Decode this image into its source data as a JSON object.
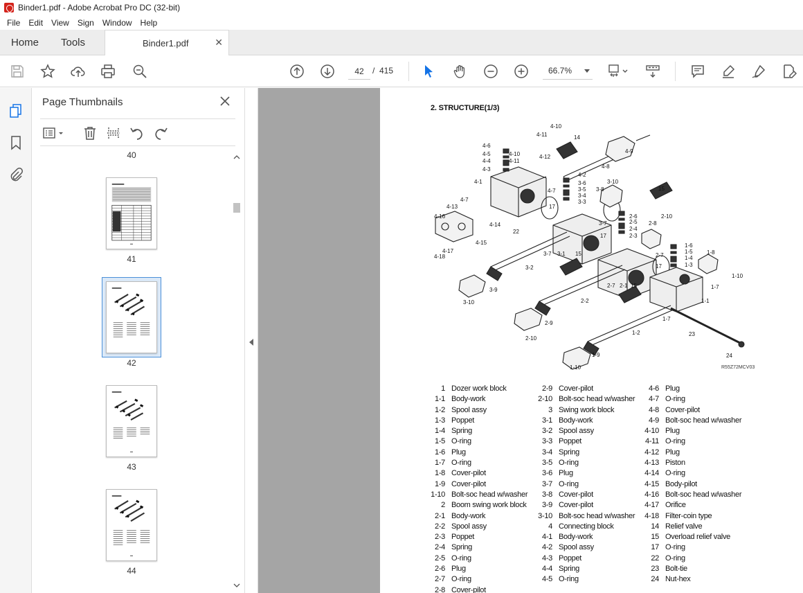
{
  "window": {
    "title": "Binder1.pdf - Adobe Acrobat Pro DC (32-bit)"
  },
  "menu": [
    "File",
    "Edit",
    "View",
    "Sign",
    "Window",
    "Help"
  ],
  "tabs": {
    "home": "Home",
    "tools": "Tools",
    "document": "Binder1.pdf"
  },
  "toolbar": {
    "current_page": "42",
    "page_separator": "/",
    "total_pages": "415",
    "zoom": "66.7%"
  },
  "thumbnail_panel": {
    "title": "Page Thumbnails",
    "pages": [
      {
        "number": "40",
        "selected": false
      },
      {
        "number": "41",
        "selected": false
      },
      {
        "number": "42",
        "selected": true
      },
      {
        "number": "43",
        "selected": false
      },
      {
        "number": "44",
        "selected": false
      }
    ]
  },
  "document": {
    "heading": "2. STRUCTURE(1/3)",
    "drawing_code": "R55Z72MCV03",
    "callouts": [
      "4-10",
      "4-11",
      "14",
      "4-6",
      "4-5",
      "4-10",
      "4-4",
      "4-11",
      "4-3",
      "4-12",
      "4-9",
      "4-8",
      "4-2",
      "4-1",
      "3-6",
      "3-5",
      "3-4",
      "3-3",
      "3-10",
      "4-7",
      "3-8",
      "15",
      "4-13",
      "4-7",
      "17",
      "2-6",
      "2-10",
      "4-16",
      "22",
      "2-5",
      "4-14",
      "2-4",
      "2-8",
      "2-3",
      "4-15",
      "17",
      "3-7",
      "1-6",
      "4-17",
      "3-7",
      "3-1",
      "15",
      "1-5",
      "1-8",
      "4-18",
      "1-4",
      "2-7",
      "1-3",
      "3-2",
      "17",
      "1-10",
      "2-7",
      "2-1",
      "15",
      "1-7",
      "3-9",
      "1-1",
      "3-10",
      "2-2",
      "1-7",
      "2-9",
      "23",
      "2-10",
      "1-2",
      "24",
      "1-9",
      "1-10"
    ],
    "parts": [
      [
        [
          "1",
          "Dozer work block"
        ],
        [
          "1-1",
          "Body-work"
        ],
        [
          "1-2",
          "Spool assy"
        ],
        [
          "1-3",
          "Poppet"
        ],
        [
          "1-4",
          "Spring"
        ],
        [
          "1-5",
          "O-ring"
        ],
        [
          "1-6",
          "Plug"
        ],
        [
          "1-7",
          "O-ring"
        ],
        [
          "1-8",
          "Cover-pilot"
        ],
        [
          "1-9",
          "Cover-pilot"
        ],
        [
          "1-10",
          "Bolt-soc head w/washer"
        ],
        [
          "2",
          "Boom swing work block"
        ],
        [
          "2-1",
          "Body-work"
        ],
        [
          "2-2",
          "Spool assy"
        ],
        [
          "2-3",
          "Poppet"
        ],
        [
          "2-4",
          "Spring"
        ],
        [
          "2-5",
          "O-ring"
        ],
        [
          "2-6",
          "Plug"
        ],
        [
          "2-7",
          "O-ring"
        ],
        [
          "2-8",
          "Cover-pilot"
        ]
      ],
      [
        [
          "2-9",
          "Cover-pilot"
        ],
        [
          "2-10",
          "Bolt-soc head w/washer"
        ],
        [
          "3",
          "Swing work block"
        ],
        [
          "3-1",
          "Body-work"
        ],
        [
          "3-2",
          "Spool assy"
        ],
        [
          "3-3",
          "Poppet"
        ],
        [
          "3-4",
          "Spring"
        ],
        [
          "3-5",
          "O-ring"
        ],
        [
          "3-6",
          "Plug"
        ],
        [
          "3-7",
          "O-ring"
        ],
        [
          "3-8",
          "Cover-pilot"
        ],
        [
          "3-9",
          "Cover-pilot"
        ],
        [
          "3-10",
          "Bolt-soc head w/washer"
        ],
        [
          "4",
          "Connecting block"
        ],
        [
          "4-1",
          "Body-work"
        ],
        [
          "4-2",
          "Spool assy"
        ],
        [
          "4-3",
          "Poppet"
        ],
        [
          "4-4",
          "Spring"
        ],
        [
          "4-5",
          "O-ring"
        ]
      ],
      [
        [
          "4-6",
          "Plug"
        ],
        [
          "4-7",
          "O-ring"
        ],
        [
          "4-8",
          "Cover-pilot"
        ],
        [
          "4-9",
          "Bolt-soc head w/washer"
        ],
        [
          "4-10",
          "Plug"
        ],
        [
          "4-11",
          "O-ring"
        ],
        [
          "4-12",
          "Plug"
        ],
        [
          "4-13",
          "Piston"
        ],
        [
          "4-14",
          "O-ring"
        ],
        [
          "4-15",
          "Body-pilot"
        ],
        [
          "4-16",
          "Bolt-soc head w/washer"
        ],
        [
          "4-17",
          "Orifice"
        ],
        [
          "4-18",
          "Filter-coin type"
        ],
        [
          "14",
          "Relief valve"
        ],
        [
          "15",
          "Overload relief valve"
        ],
        [
          "17",
          "O-ring"
        ],
        [
          "22",
          "O-ring"
        ],
        [
          "23",
          "Bolt-tie"
        ],
        [
          "24",
          "Nut-hex"
        ]
      ]
    ]
  },
  "colors": {
    "accent": "#1473e6",
    "selection": "#4a8fd8",
    "doc_background": "#a5a5a5"
  }
}
